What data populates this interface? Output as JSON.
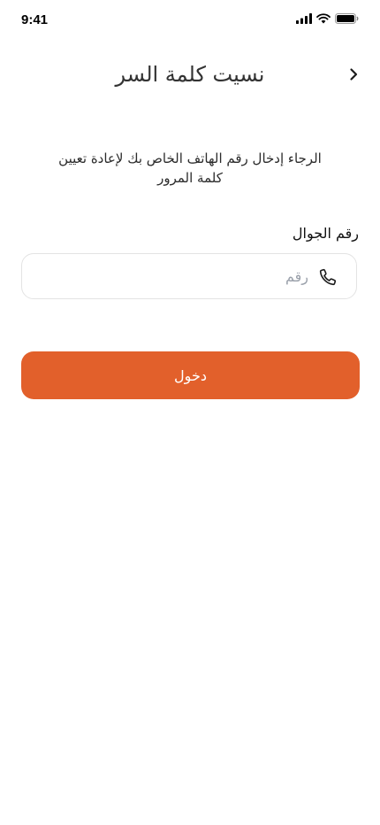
{
  "status_bar": {
    "time": "9:41",
    "icons": [
      "cellular-signal-icon",
      "wifi-icon",
      "battery-icon"
    ]
  },
  "header": {
    "title": "نسيت كلمة السر",
    "back_icon": "chevron-right-icon"
  },
  "instructions": {
    "text": "الرجاء إدخال رقم الهاتف  الخاص بك لإعادة تعيين كلمة المرور"
  },
  "phone_field": {
    "label": "رقم الجوال",
    "placeholder": "رقم",
    "value": "",
    "icon": "phone-icon"
  },
  "submit": {
    "label": "دخول"
  },
  "colors": {
    "accent": "#e2602b",
    "field_border": "#e3e3e3",
    "placeholder": "#9aa0aa",
    "background": "#ffffff"
  }
}
